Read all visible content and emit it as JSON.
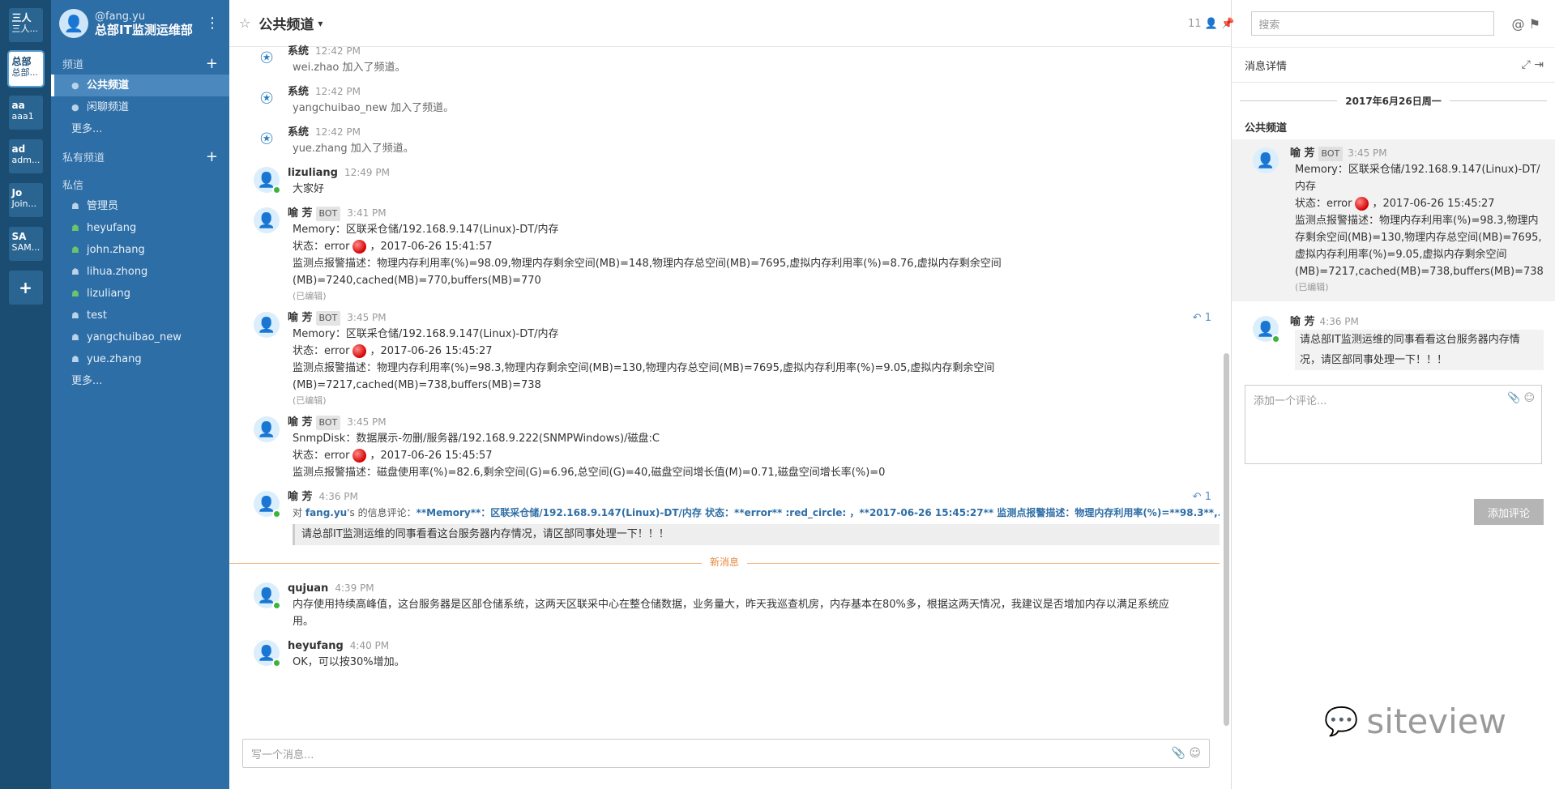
{
  "teams": [
    {
      "abbr": "三人",
      "name": "三人..."
    },
    {
      "abbr": "总部",
      "name": "总部..."
    },
    {
      "abbr": "aa",
      "name": "aaa1"
    },
    {
      "abbr": "ad",
      "name": "adm..."
    },
    {
      "abbr": "Jo",
      "name": "Join..."
    },
    {
      "abbr": "SA",
      "name": "SAM..."
    }
  ],
  "team_add": "+",
  "sidebar": {
    "user_handle": "@fang.yu",
    "team_name": "总部IT监测运维部",
    "channels_label": "频道",
    "channels": [
      "公共频道",
      "闲聊频道"
    ],
    "channels_more": "更多...",
    "private_label": "私有频道",
    "dm_label": "私信",
    "dms": [
      "管理员",
      "heyufang",
      "john.zhang",
      "lihua.zhong",
      "lizuliang",
      "test",
      "yangchuibao_new",
      "yue.zhang"
    ],
    "dms_more": "更多..."
  },
  "header": {
    "channel_title": "公共频道",
    "member_count": "11",
    "search_placeholder": "搜索"
  },
  "messages": [
    {
      "name": "系统",
      "time": "12:42 PM",
      "text": "wei.zhao 加入了频道。"
    },
    {
      "name": "系统",
      "time": "12:42 PM",
      "text": "yangchuibao_new 加入了频道。"
    },
    {
      "name": "系统",
      "time": "12:42 PM",
      "text": "yue.zhang 加入了频道。"
    },
    {
      "name": "lizuliang",
      "time": "12:49 PM",
      "text": "大家好"
    },
    {
      "name": "喻 芳",
      "bot": "BOT",
      "time": "3:41 PM",
      "l1": "Memory：区联采仓储/192.168.9.147(Linux)-DT/内存",
      "l2a": "状态：error",
      "l2b": "，2017-06-26 15:41:57",
      "l3": "监测点报警描述：物理内存利用率(%)=98.09,物理内存剩余空间(MB)=148,物理内存总空间(MB)=7695,虚拟内存利用率(%)=8.76,虚拟内存剩余空间",
      "l4": "(MB)=7240,cached(MB)=770,buffers(MB)=770",
      "edited": "(已编辑)"
    },
    {
      "name": "喻 芳",
      "bot": "BOT",
      "time": "3:45 PM",
      "reply": "1",
      "l1": "Memory：区联采仓储/192.168.9.147(Linux)-DT/内存",
      "l2a": "状态：error",
      "l2b": "，2017-06-26 15:45:27",
      "l3": "监测点报警描述：物理内存利用率(%)=98.3,物理内存剩余空间(MB)=130,物理内存总空间(MB)=7695,虚拟内存利用率(%)=9.05,虚拟内存剩余空间",
      "l4": "(MB)=7217,cached(MB)=738,buffers(MB)=738",
      "edited": "(已编辑)"
    },
    {
      "name": "喻 芳",
      "bot": "BOT",
      "time": "3:45 PM",
      "l1": "SnmpDisk：数据展示-勿删/服务器/192.168.9.222(SNMPWindows)/磁盘:C",
      "l2a": "状态：error",
      "l2b": "，2017-06-26 15:45:57",
      "l3": "监测点报警描述：磁盘使用率(%)=82.6,剩余空间(G)=6.96,总空间(G)=40,磁盘空间增长值(M)=0.71,磁盘空间增长率(%)=0"
    },
    {
      "name": "喻 芳",
      "time": "4:36 PM",
      "reply": "1",
      "quote_prefix": "对",
      "quote_user": "fang.yu",
      "quote_mid": "'s 的信息评论：",
      "quote_text": "**Memory**：区联采仓储/192.168.9.147(Linux)-DT/内存 状态：**error** :red_circle: ，**2017-06-26 15:45:27** 监测点报警描述：物理内存利用率(%)=**98.3**,...",
      "text": "请总部IT监测运维的同事看看这台服务器内存情况，请区部同事处理一下！！！"
    },
    {
      "name": "qujuan",
      "time": "4:39 PM",
      "l1": "内存使用持续高峰值，这台服务器是区部仓储系统，这两天区联采中心在整仓储数据，业务量大，昨天我巡查机房，内存基本在80%多，根据这两天情况，我建议是否增加内存以满足系统应",
      "l2": "用。"
    },
    {
      "name": "heyufang",
      "time": "4:40 PM",
      "text": "OK，可以按30%增加。"
    }
  ],
  "new_messages_label": "新消息",
  "composer_placeholder": "写一个消息...",
  "detail": {
    "title": "消息详情",
    "date": "2017年6月26日周一",
    "channel": "公共频道",
    "root": {
      "name": "喻 芳",
      "bot": "BOT",
      "time": "3:45 PM",
      "l1": "Memory：区联采仓储/192.168.9.147(Linux)-DT/",
      "l2": "内存",
      "l3a": "状态：error",
      "l3b": "，2017-06-26 15:45:27",
      "l4": "监测点报警描述：物理内存利用率(%)=98.3,物理内",
      "l5": "存剩余空间(MB)=130,物理内存总空间(MB)=7695,",
      "l6": "虚拟内存利用率(%)=9.05,虚拟内存剩余空间",
      "l7": "(MB)=7217,cached(MB)=738,buffers(MB)=738",
      "edited": "(已编辑)"
    },
    "reply": {
      "name": "喻 芳",
      "time": "4:36 PM",
      "l1": "请总部IT监测运维的同事看看这台服务器内存情",
      "l2": "况，请区部同事处理一下！！！"
    },
    "comment_placeholder": "添加一个评论...",
    "add_comment_label": "添加评论"
  },
  "watermark": "siteview",
  "colors": {
    "team_bar": "#1b4d73",
    "sidebar": "#2e6ea6",
    "accent": "#5c8ec2"
  }
}
